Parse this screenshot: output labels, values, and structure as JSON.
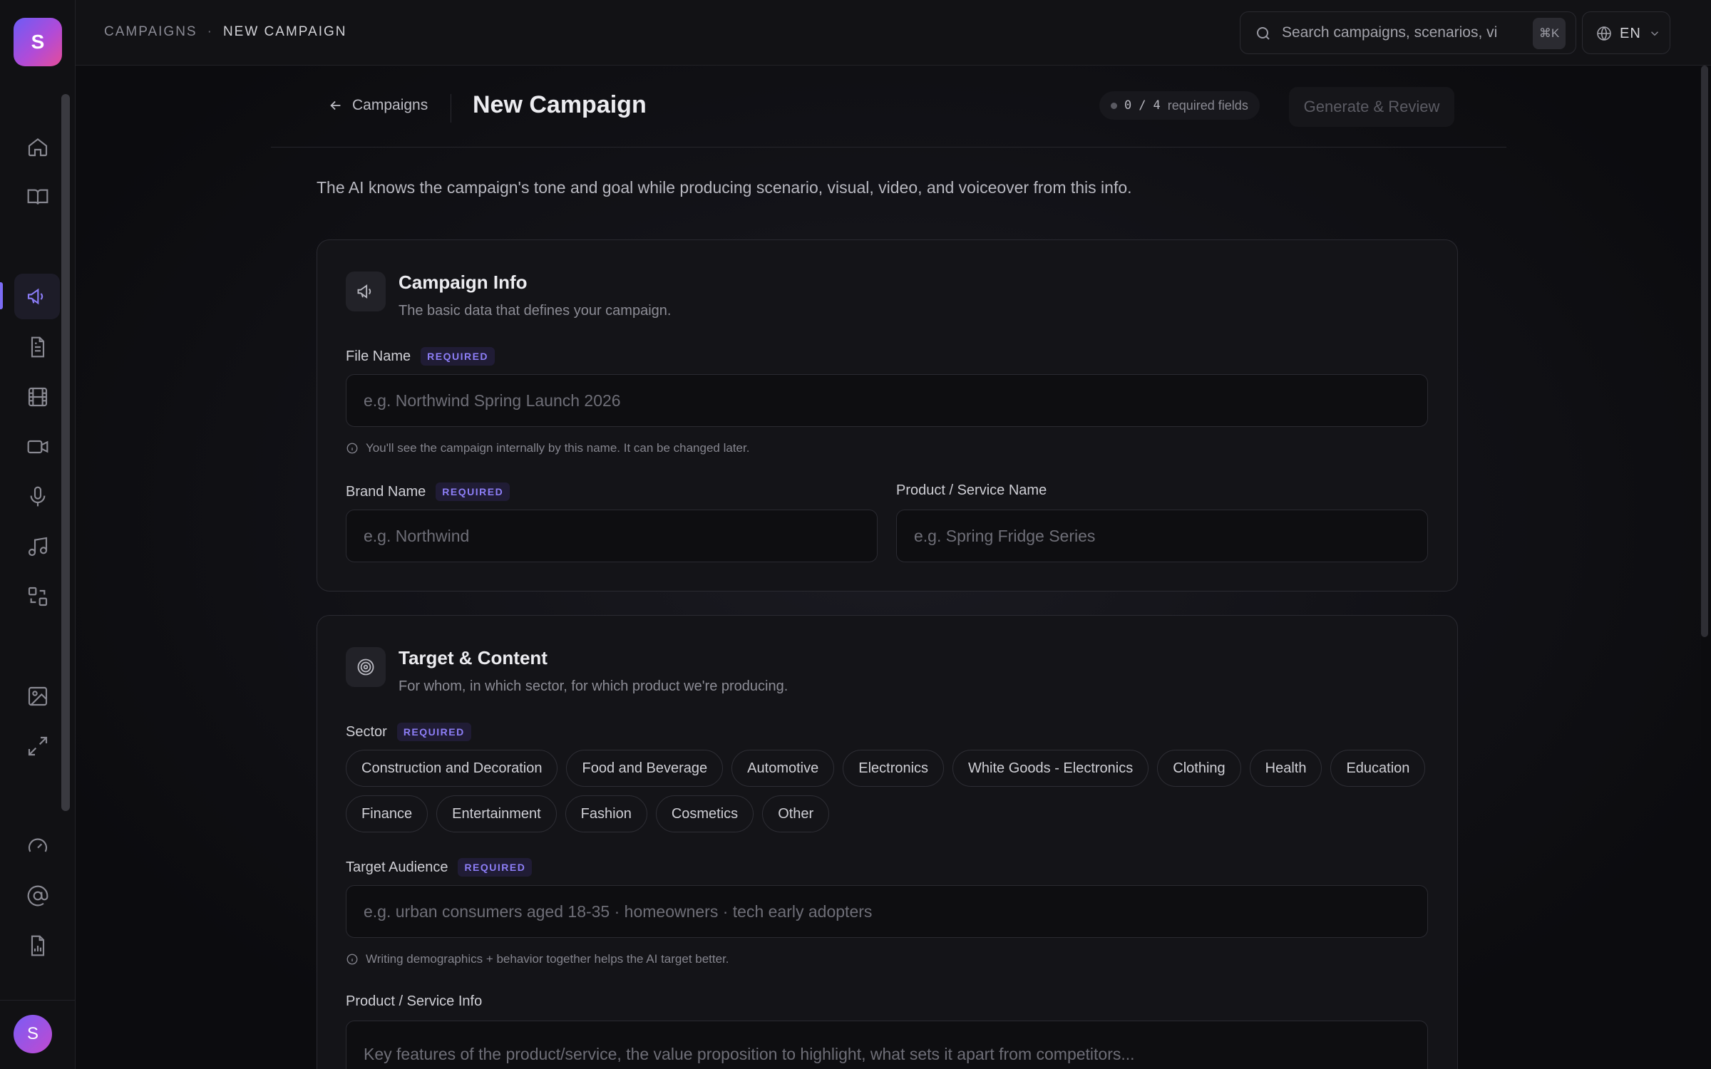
{
  "app": {
    "logo_letter": "S",
    "user_initial": "S"
  },
  "sidebar": {
    "items": [
      {
        "icon": "home-icon"
      },
      {
        "icon": "book-icon"
      },
      {
        "icon": "megaphone-icon",
        "active": true
      },
      {
        "icon": "document-icon"
      },
      {
        "icon": "film-icon"
      },
      {
        "icon": "video-camera-icon"
      },
      {
        "icon": "microphone-icon"
      },
      {
        "icon": "music-note-icon"
      },
      {
        "icon": "transform-icon"
      },
      {
        "icon": "image-icon"
      },
      {
        "icon": "expand-icon"
      },
      {
        "icon": "gauge-icon"
      },
      {
        "icon": "at-sign-icon"
      },
      {
        "icon": "report-icon"
      }
    ],
    "accent_color": "#7c6cf5"
  },
  "topbar": {
    "breadcrumb": [
      "CAMPAIGNS",
      "NEW CAMPAIGN"
    ],
    "breadcrumb_sep": "·",
    "search_placeholder": "Search campaigns, scenarios, vi",
    "search_shortcut": "⌘K",
    "language": "EN"
  },
  "header": {
    "back_label": "Campaigns",
    "title": "New Campaign",
    "required_done": "0",
    "required_sep": "/",
    "required_total": "4",
    "required_label": "required fields",
    "generate_label": "Generate & Review"
  },
  "intro": "The AI knows the campaign's tone and goal while producing scenario, visual, video, and voiceover from this info.",
  "campaign_info": {
    "title": "Campaign Info",
    "subtitle": "The basic data that defines your campaign.",
    "required_badge": "REQUIRED",
    "file_name_label": "File Name",
    "file_name_placeholder": "e.g. Northwind Spring Launch 2026",
    "file_name_hint": "You'll see the campaign internally by this name. It can be changed later.",
    "brand_label": "Brand Name",
    "brand_placeholder": "e.g. Northwind",
    "product_label": "Product / Service Name",
    "product_placeholder": "e.g. Spring Fridge Series"
  },
  "target_content": {
    "title": "Target & Content",
    "subtitle": "For whom, in which sector, for which product we're producing.",
    "required_badge": "REQUIRED",
    "sector_label": "Sector",
    "sectors": [
      "Construction and Decoration",
      "Food and Beverage",
      "Automotive",
      "Electronics",
      "White Goods - Electronics",
      "Clothing",
      "Health",
      "Education",
      "Finance",
      "Entertainment",
      "Fashion",
      "Cosmetics",
      "Other"
    ],
    "audience_label": "Target Audience",
    "audience_placeholder": "e.g. urban consumers aged 18-35 · homeowners · tech early adopters",
    "audience_hint": "Writing demographics + behavior together helps the AI target better.",
    "info_label": "Product / Service Info",
    "info_placeholder": "Key features of the product/service, the value proposition to highlight, what sets it apart from competitors..."
  }
}
